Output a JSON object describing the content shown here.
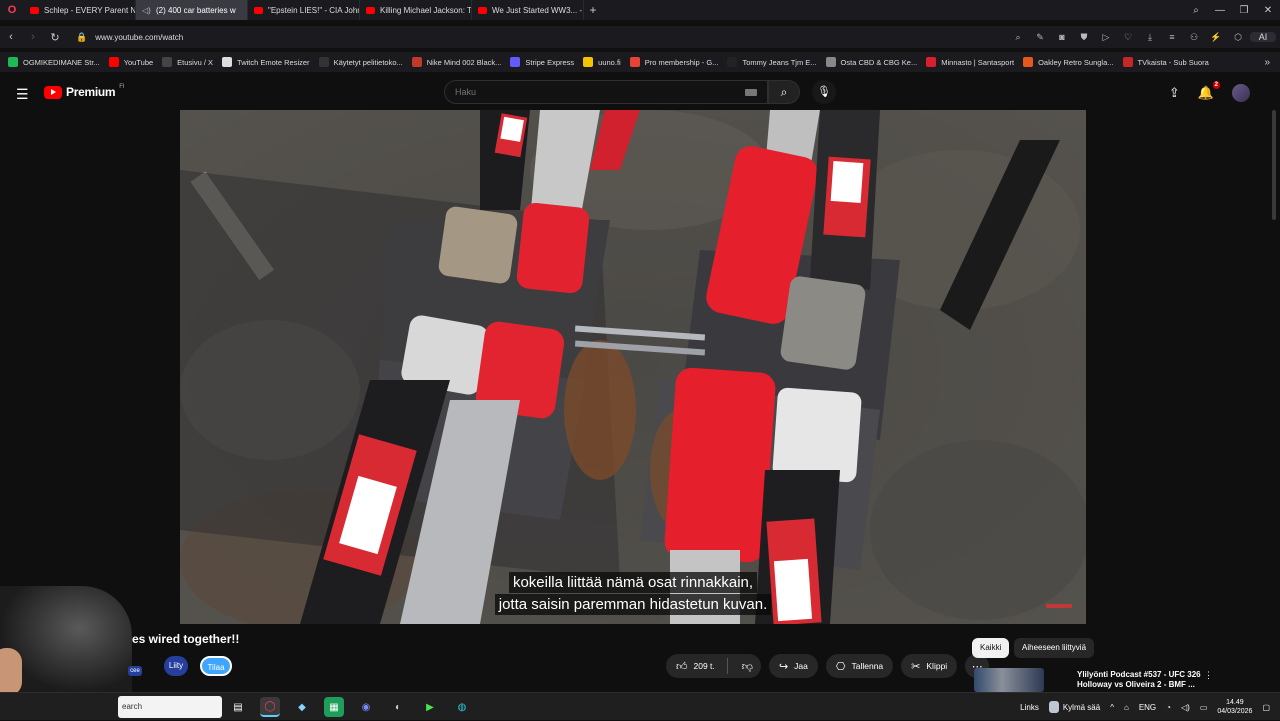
{
  "browser": {
    "tabs": [
      {
        "title": "Schlep - EVERY Parent Ne",
        "icon": "youtube-icon",
        "active": false
      },
      {
        "title": "(2) 400 car batteries w",
        "icon": "speaker-icon",
        "active": true
      },
      {
        "title": "\"Epstein LIES!\" - CIA John",
        "icon": "youtube-icon",
        "active": false
      },
      {
        "title": "Killing Michael Jackson: T",
        "icon": "youtube-icon",
        "active": false
      },
      {
        "title": "We Just Started WW3... - Y",
        "icon": "youtube-icon",
        "active": false
      }
    ],
    "new_tab": "+",
    "url": "www.youtube.com/watch",
    "aria_label": "AI",
    "bookmarks": [
      {
        "label": "OGMIKEDIMANE Str...",
        "color": "#1db954"
      },
      {
        "label": "YouTube",
        "color": "#ff0000"
      },
      {
        "label": "Etusivu / X",
        "color": "#444444"
      },
      {
        "label": "Twitch Emote Resizer",
        "color": "#dddddd"
      },
      {
        "label": "Käytetyt pelitietoko...",
        "color": "#333333"
      },
      {
        "label": "Nike Mind 002 Black...",
        "color": "#c0392b"
      },
      {
        "label": "Stripe Express",
        "color": "#635bff"
      },
      {
        "label": "uuno.fi",
        "color": "#f5c400"
      },
      {
        "label": "Pro membership - G...",
        "color": "#ea4335"
      },
      {
        "label": "Tommy Jeans Tjm E...",
        "color": "#222222"
      },
      {
        "label": "Osta CBD & CBG Ke...",
        "color": "#888888"
      },
      {
        "label": "Minnasto | Santasport",
        "color": "#d91e2e"
      },
      {
        "label": "Oakley Retro Sungla...",
        "color": "#e55a1c"
      },
      {
        "label": "TVkaista - Sub Suora",
        "color": "#c62828"
      }
    ]
  },
  "youtube": {
    "brand": "Premium",
    "brand_sup": "FI",
    "search_placeholder": "Haku",
    "notification_count": "2",
    "subtitles": [
      "kokeilla liittää nämä osat rinnakkain,",
      "jotta saisin paremman hidastetun kuvan."
    ],
    "video_title": "es wired together!!",
    "join_label": "Liity",
    "subscribe_label": "Tilaa",
    "channel_chip": "cee",
    "like_count": "209 t.",
    "share_label": "Jaa",
    "save_label": "Tallenna",
    "clip_label": "Klippi",
    "filter_all": "Kaikki",
    "filter_related": "Aiheeseen liittyviä",
    "reco_title_line1": "Ylilyönti Podcast #537 - UFC 326",
    "reco_title_line2": "Holloway vs Oliveira 2 - BMF ...",
    "accent": "#ff0000",
    "subscribe_color": "#3ea6ff"
  },
  "taskbar": {
    "search_placeholder": "earch",
    "links_label": "Links",
    "weather": "Kylmä sää",
    "language": "ENG",
    "time": "14.49",
    "date": "04/03/2026"
  }
}
